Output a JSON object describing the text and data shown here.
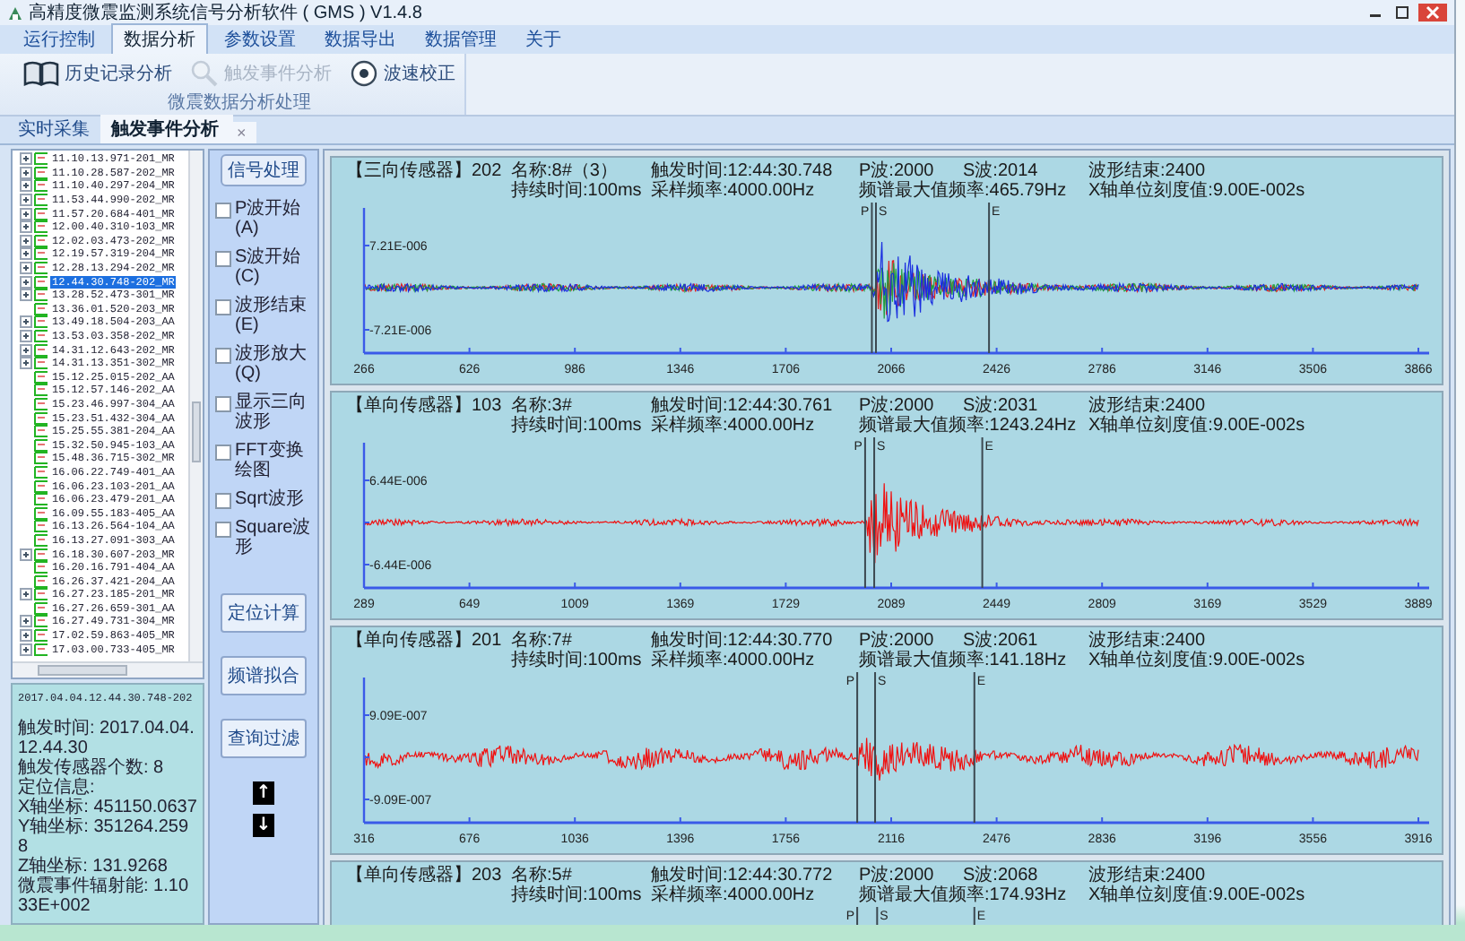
{
  "window": {
    "title": "高精度微震监测系统信号分析软件 ( GMS ) V1.4.8"
  },
  "menu": [
    {
      "label": "运行控制",
      "selected": false
    },
    {
      "label": "数据分析",
      "selected": true
    },
    {
      "label": "参数设置",
      "selected": false
    },
    {
      "label": "数据导出",
      "selected": false
    },
    {
      "label": "数据管理",
      "selected": false
    },
    {
      "label": "关于",
      "selected": false
    }
  ],
  "ribbon": {
    "group": "微震数据分析处理",
    "buttons": [
      {
        "label": "历史记录分析",
        "kind": "book",
        "disabled": false
      },
      {
        "label": "触发事件分析",
        "kind": "search",
        "disabled": true
      },
      {
        "label": "波速校正",
        "kind": "target",
        "disabled": false
      }
    ]
  },
  "doc_tabs": [
    {
      "label": "实时采集",
      "selected": false
    },
    {
      "label": "触发事件分析",
      "selected": true,
      "close": "×"
    }
  ],
  "tree": {
    "items": [
      {
        "label": "11.10.13.971-201_MR",
        "expandable": true,
        "selected": false
      },
      {
        "label": "11.10.28.587-202_MR",
        "expandable": true,
        "selected": false
      },
      {
        "label": "11.10.40.297-204_MR",
        "expandable": true,
        "selected": false
      },
      {
        "label": "11.53.44.990-202_MR",
        "expandable": true,
        "selected": false
      },
      {
        "label": "11.57.20.684-401_MR",
        "expandable": true,
        "selected": false
      },
      {
        "label": "12.00.40.310-103_MR",
        "expandable": true,
        "selected": false
      },
      {
        "label": "12.02.03.473-202_MR",
        "expandable": true,
        "selected": false
      },
      {
        "label": "12.19.57.319-204_MR",
        "expandable": true,
        "selected": false
      },
      {
        "label": "12.28.13.294-202_MR",
        "expandable": true,
        "selected": false
      },
      {
        "label": "12.44.30.748-202_MR",
        "expandable": true,
        "selected": true
      },
      {
        "label": "13.28.52.473-301_MR",
        "expandable": true,
        "selected": false
      },
      {
        "label": "13.36.01.520-203_MR",
        "expandable": false,
        "selected": false
      },
      {
        "label": "13.49.18.504-203_AA",
        "expandable": true,
        "selected": false
      },
      {
        "label": "13.53.03.358-202_MR",
        "expandable": true,
        "selected": false
      },
      {
        "label": "14.31.12.643-202_MR",
        "expandable": true,
        "selected": false
      },
      {
        "label": "14.31.13.351-302_MR",
        "expandable": true,
        "selected": false
      },
      {
        "label": "15.12.25.015-202_AA",
        "expandable": false,
        "selected": false
      },
      {
        "label": "15.12.57.146-202_AA",
        "expandable": false,
        "selected": false
      },
      {
        "label": "15.23.46.997-304_AA",
        "expandable": false,
        "selected": false
      },
      {
        "label": "15.23.51.432-304_AA",
        "expandable": false,
        "selected": false
      },
      {
        "label": "15.25.55.381-204_AA",
        "expandable": false,
        "selected": false
      },
      {
        "label": "15.32.50.945-103_AA",
        "expandable": false,
        "selected": false
      },
      {
        "label": "15.48.36.715-302_MR",
        "expandable": false,
        "selected": false
      },
      {
        "label": "16.06.22.749-401_AA",
        "expandable": false,
        "selected": false
      },
      {
        "label": "16.06.23.103-201_AA",
        "expandable": false,
        "selected": false
      },
      {
        "label": "16.06.23.479-201_AA",
        "expandable": false,
        "selected": false
      },
      {
        "label": "16.09.55.183-405_AA",
        "expandable": false,
        "selected": false
      },
      {
        "label": "16.13.26.564-104_AA",
        "expandable": false,
        "selected": false
      },
      {
        "label": "16.13.27.091-303_AA",
        "expandable": false,
        "selected": false
      },
      {
        "label": "16.18.30.607-203_MR",
        "expandable": true,
        "selected": false
      },
      {
        "label": "16.20.16.791-404_AA",
        "expandable": false,
        "selected": false
      },
      {
        "label": "16.26.37.421-204_AA",
        "expandable": false,
        "selected": false
      },
      {
        "label": "16.27.23.185-201_MR",
        "expandable": true,
        "selected": false
      },
      {
        "label": "16.27.26.659-301_AA",
        "expandable": false,
        "selected": false
      },
      {
        "label": "16.27.49.731-304_MR",
        "expandable": true,
        "selected": false
      },
      {
        "label": "17.02.59.863-405_MR",
        "expandable": true,
        "selected": false
      },
      {
        "label": "17.03.00.733-405_MR",
        "expandable": true,
        "selected": false
      }
    ]
  },
  "tools": {
    "header": "信号处理",
    "options": [
      {
        "label": "P波开始(A)",
        "checked": false
      },
      {
        "label": "S波开始(C)",
        "checked": false
      },
      {
        "label": "波形结束(E)",
        "checked": false
      },
      {
        "label": "波形放大(Q)",
        "checked": false
      },
      {
        "label": "显示三向波形",
        "checked": false
      },
      {
        "label": "FFT变换绘图",
        "checked": false
      },
      {
        "label": "Sqrt波形",
        "checked": false
      },
      {
        "label": "Square波形",
        "checked": false
      }
    ],
    "buttons": [
      "定位计算",
      "频谱拟合",
      "查询过滤"
    ],
    "arrows": [
      "↑",
      "↓"
    ]
  },
  "info": {
    "event": "2017.04.04.12.44.30.748-202",
    "lines": [
      "触发时间: 2017.04.04.12.44.30",
      "触发传感器个数: 8",
      "定位信息:",
      "X轴坐标: 451150.0637",
      "Y轴坐标: 351264.2598",
      "Z轴坐标: 131.9268",
      "微震事件辐射能: 1.1033E+002"
    ]
  },
  "charts": [
    {
      "sensor": "【三向传感器】202",
      "name": "名称:8#（3）",
      "trigger_time": "触发时间:12:44:30.748",
      "p_wave": "P波:2000",
      "s_wave": "S波:2014",
      "wave_end": "波形结束:2400",
      "duration": "持续时间:100ms",
      "sample_rate": "采样频率:4000.00Hz",
      "peak_frequency": "频谱最大值频率:465.79Hz",
      "x_unit": "X轴单位刻度值:9.00E-002s",
      "markers": [
        {
          "label": "P",
          "kind": "p"
        },
        {
          "label": "S",
          "kind": "s"
        },
        {
          "label": "E",
          "kind": "end"
        }
      ],
      "traces": [
        {
          "color": "#e02020"
        },
        {
          "color": "#20a040"
        },
        {
          "color": "#1a2ee0"
        }
      ],
      "y_ticks": [
        "7.21E-006",
        "-7.21E-006"
      ],
      "x_ticks": [
        "266",
        "626",
        "986",
        "1346",
        "1706",
        "2066",
        "2426",
        "2786",
        "3146",
        "3506",
        "3866"
      ]
    },
    {
      "sensor": "【单向传感器】103",
      "name": "名称:3#",
      "trigger_time": "触发时间:12:44:30.761",
      "p_wave": "P波:2000",
      "s_wave": "S波:2031",
      "wave_end": "波形结束:2400",
      "duration": "持续时间:100ms",
      "sample_rate": "采样频率:4000.00Hz",
      "peak_frequency": "频谱最大值频率:1243.24Hz",
      "x_unit": "X轴单位刻度值:9.00E-002s",
      "markers": [
        {
          "label": "P",
          "kind": "p"
        },
        {
          "label": "S",
          "kind": "s"
        },
        {
          "label": "E",
          "kind": "end"
        }
      ],
      "traces": [
        {
          "color": "#f01010"
        }
      ],
      "y_ticks": [
        "6.44E-006",
        "-6.44E-006"
      ],
      "x_ticks": [
        "289",
        "649",
        "1009",
        "1369",
        "1729",
        "2089",
        "2449",
        "2809",
        "3169",
        "3529",
        "3889"
      ]
    },
    {
      "sensor": "【单向传感器】201",
      "name": "名称:7#",
      "trigger_time": "触发时间:12:44:30.770",
      "p_wave": "P波:2000",
      "s_wave": "S波:2061",
      "wave_end": "波形结束:2400",
      "duration": "持续时间:100ms",
      "sample_rate": "采样频率:4000.00Hz",
      "peak_frequency": "频谱最大值频率:141.18Hz",
      "x_unit": "X轴单位刻度值:9.00E-002s",
      "markers": [
        {
          "label": "P",
          "kind": "p"
        },
        {
          "label": "S",
          "kind": "s"
        },
        {
          "label": "E",
          "kind": "end"
        }
      ],
      "traces": [
        {
          "color": "#f01010"
        }
      ],
      "y_ticks": [
        "9.09E-007",
        "-9.09E-007"
      ],
      "x_ticks": [
        "316",
        "676",
        "1036",
        "1396",
        "1756",
        "2116",
        "2476",
        "2836",
        "3196",
        "3556",
        "3916"
      ]
    },
    {
      "sensor": "【单向传感器】203",
      "name": "名称:5#",
      "trigger_time": "触发时间:12:44:30.772",
      "p_wave": "P波:2000",
      "s_wave": "S波:2068",
      "wave_end": "波形结束:2400",
      "duration": "持续时间:100ms",
      "sample_rate": "采样频率:4000.00Hz",
      "peak_frequency": "频谱最大值频率:174.93Hz",
      "x_unit": "X轴单位刻度值:9.00E-002s",
      "markers": [
        {
          "label": "P",
          "kind": "p"
        },
        {
          "label": "S",
          "kind": "s"
        },
        {
          "label": "E",
          "kind": "end"
        }
      ]
    }
  ]
}
